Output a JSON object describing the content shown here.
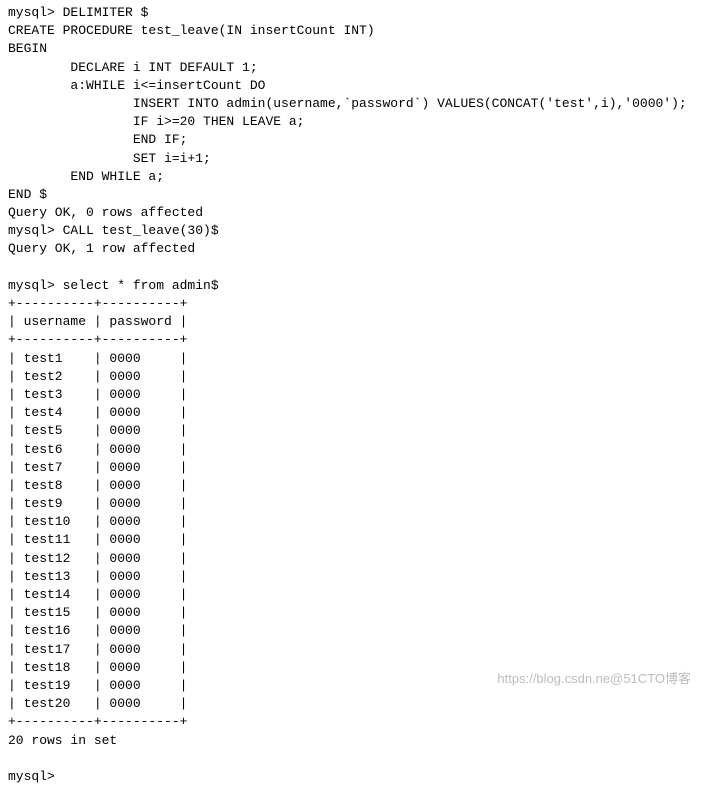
{
  "lines": [
    "mysql> DELIMITER $",
    "CREATE PROCEDURE test_leave(IN insertCount INT)",
    "BEGIN",
    "        DECLARE i INT DEFAULT 1;",
    "        a:WHILE i<=insertCount DO",
    "                INSERT INTO admin(username,`password`) VALUES(CONCAT('test',i),'0000');",
    "                IF i>=20 THEN LEAVE a;",
    "                END IF;",
    "                SET i=i+1;",
    "        END WHILE a;",
    "END $",
    "Query OK, 0 rows affected",
    "mysql> CALL test_leave(30)$",
    "Query OK, 1 row affected",
    "",
    "mysql> select * from admin$",
    "+----------+----------+",
    "| username | password |",
    "+----------+----------+",
    "| test1    | 0000     |",
    "| test2    | 0000     |",
    "| test3    | 0000     |",
    "| test4    | 0000     |",
    "| test5    | 0000     |",
    "| test6    | 0000     |",
    "| test7    | 0000     |",
    "| test8    | 0000     |",
    "| test9    | 0000     |",
    "| test10   | 0000     |",
    "| test11   | 0000     |",
    "| test12   | 0000     |",
    "| test13   | 0000     |",
    "| test14   | 0000     |",
    "| test15   | 0000     |",
    "| test16   | 0000     |",
    "| test17   | 0000     |",
    "| test18   | 0000     |",
    "| test19   | 0000     |",
    "| test20   | 0000     |",
    "+----------+----------+",
    "20 rows in set",
    "",
    "mysql>"
  ],
  "watermark": "https://blog.csdn.ne@51CTO博客"
}
